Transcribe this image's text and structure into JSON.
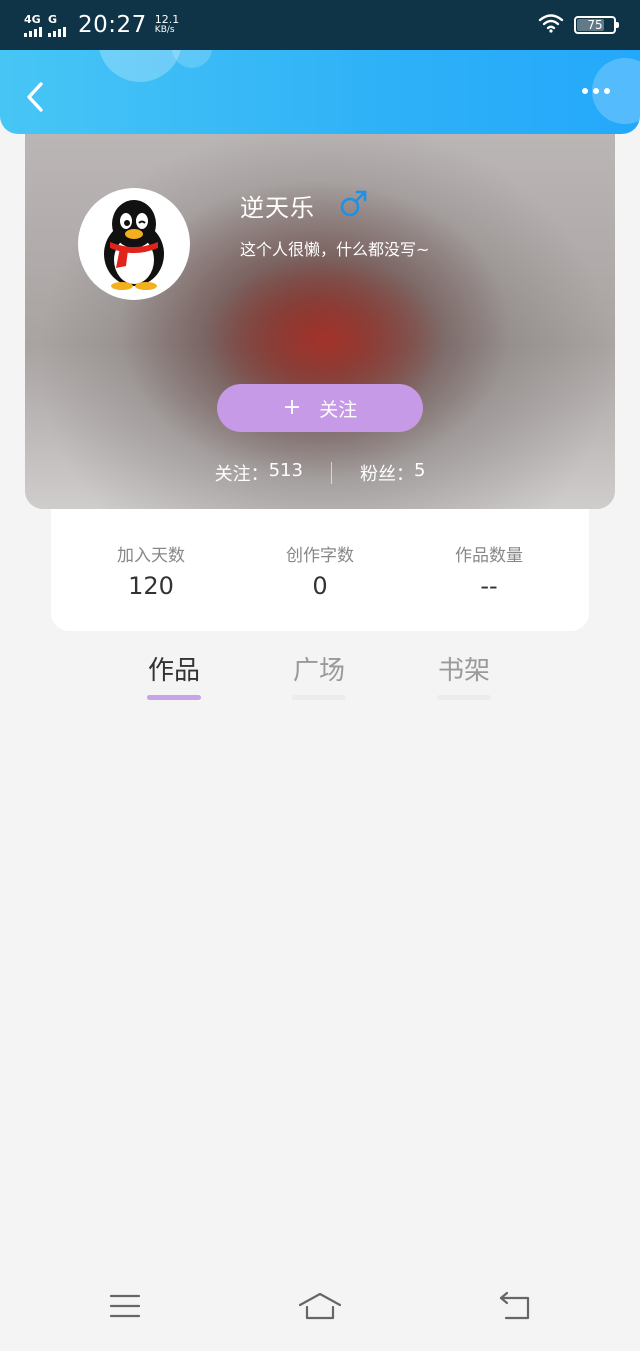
{
  "status_bar": {
    "network_1": "4G",
    "network_2": "G",
    "time": "20:27",
    "speed_value": "12.1",
    "speed_unit": "KB/s",
    "battery": "75"
  },
  "header": {
    "back_icon": "chevron-left-icon",
    "more_icon": "more-dots-icon"
  },
  "profile": {
    "username": "逆天乐",
    "gender_icon": "male-icon",
    "bio": "这个人很懒，什么都没写~",
    "follow_plus": "+",
    "follow_label": "关注",
    "following_label": "关注：",
    "following_count": "513",
    "fans_label": "粉丝：",
    "fans_count": "5"
  },
  "stats": [
    {
      "label": "加入天数",
      "value": "120"
    },
    {
      "label": "创作字数",
      "value": "0"
    },
    {
      "label": "作品数量",
      "value": "--"
    }
  ],
  "tabs": [
    {
      "label": "作品",
      "active": true
    },
    {
      "label": "广场",
      "active": false
    },
    {
      "label": "书架",
      "active": false
    }
  ],
  "navbar": {
    "menu_icon": "menu-icon",
    "home_icon": "home-icon",
    "back_icon": "back-arrow-icon"
  },
  "colors": {
    "header_gradient_start": "#47c6f5",
    "header_gradient_end": "#24a8fb",
    "follow_button": "#c69ae6",
    "active_tab_underline": "#c9a3e8",
    "gender_icon": "#1e90e8"
  }
}
